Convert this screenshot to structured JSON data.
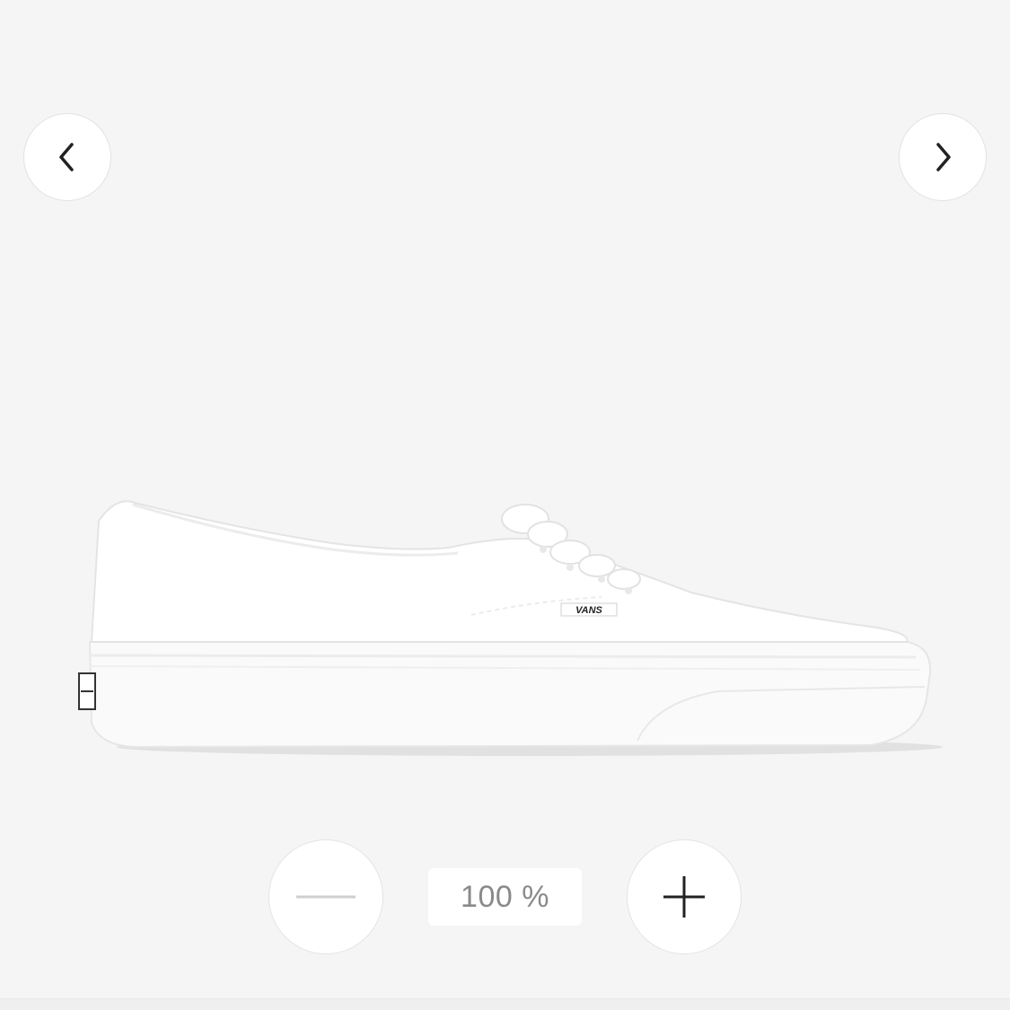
{
  "viewer": {
    "nav": {
      "prev_icon": "chevron-left-icon",
      "next_icon": "chevron-right-icon"
    },
    "product": {
      "brand_label": "VANS",
      "color": "#ffffff"
    },
    "zoom": {
      "minus_icon": "minus-icon",
      "plus_icon": "plus-icon",
      "level": "100 %"
    }
  }
}
